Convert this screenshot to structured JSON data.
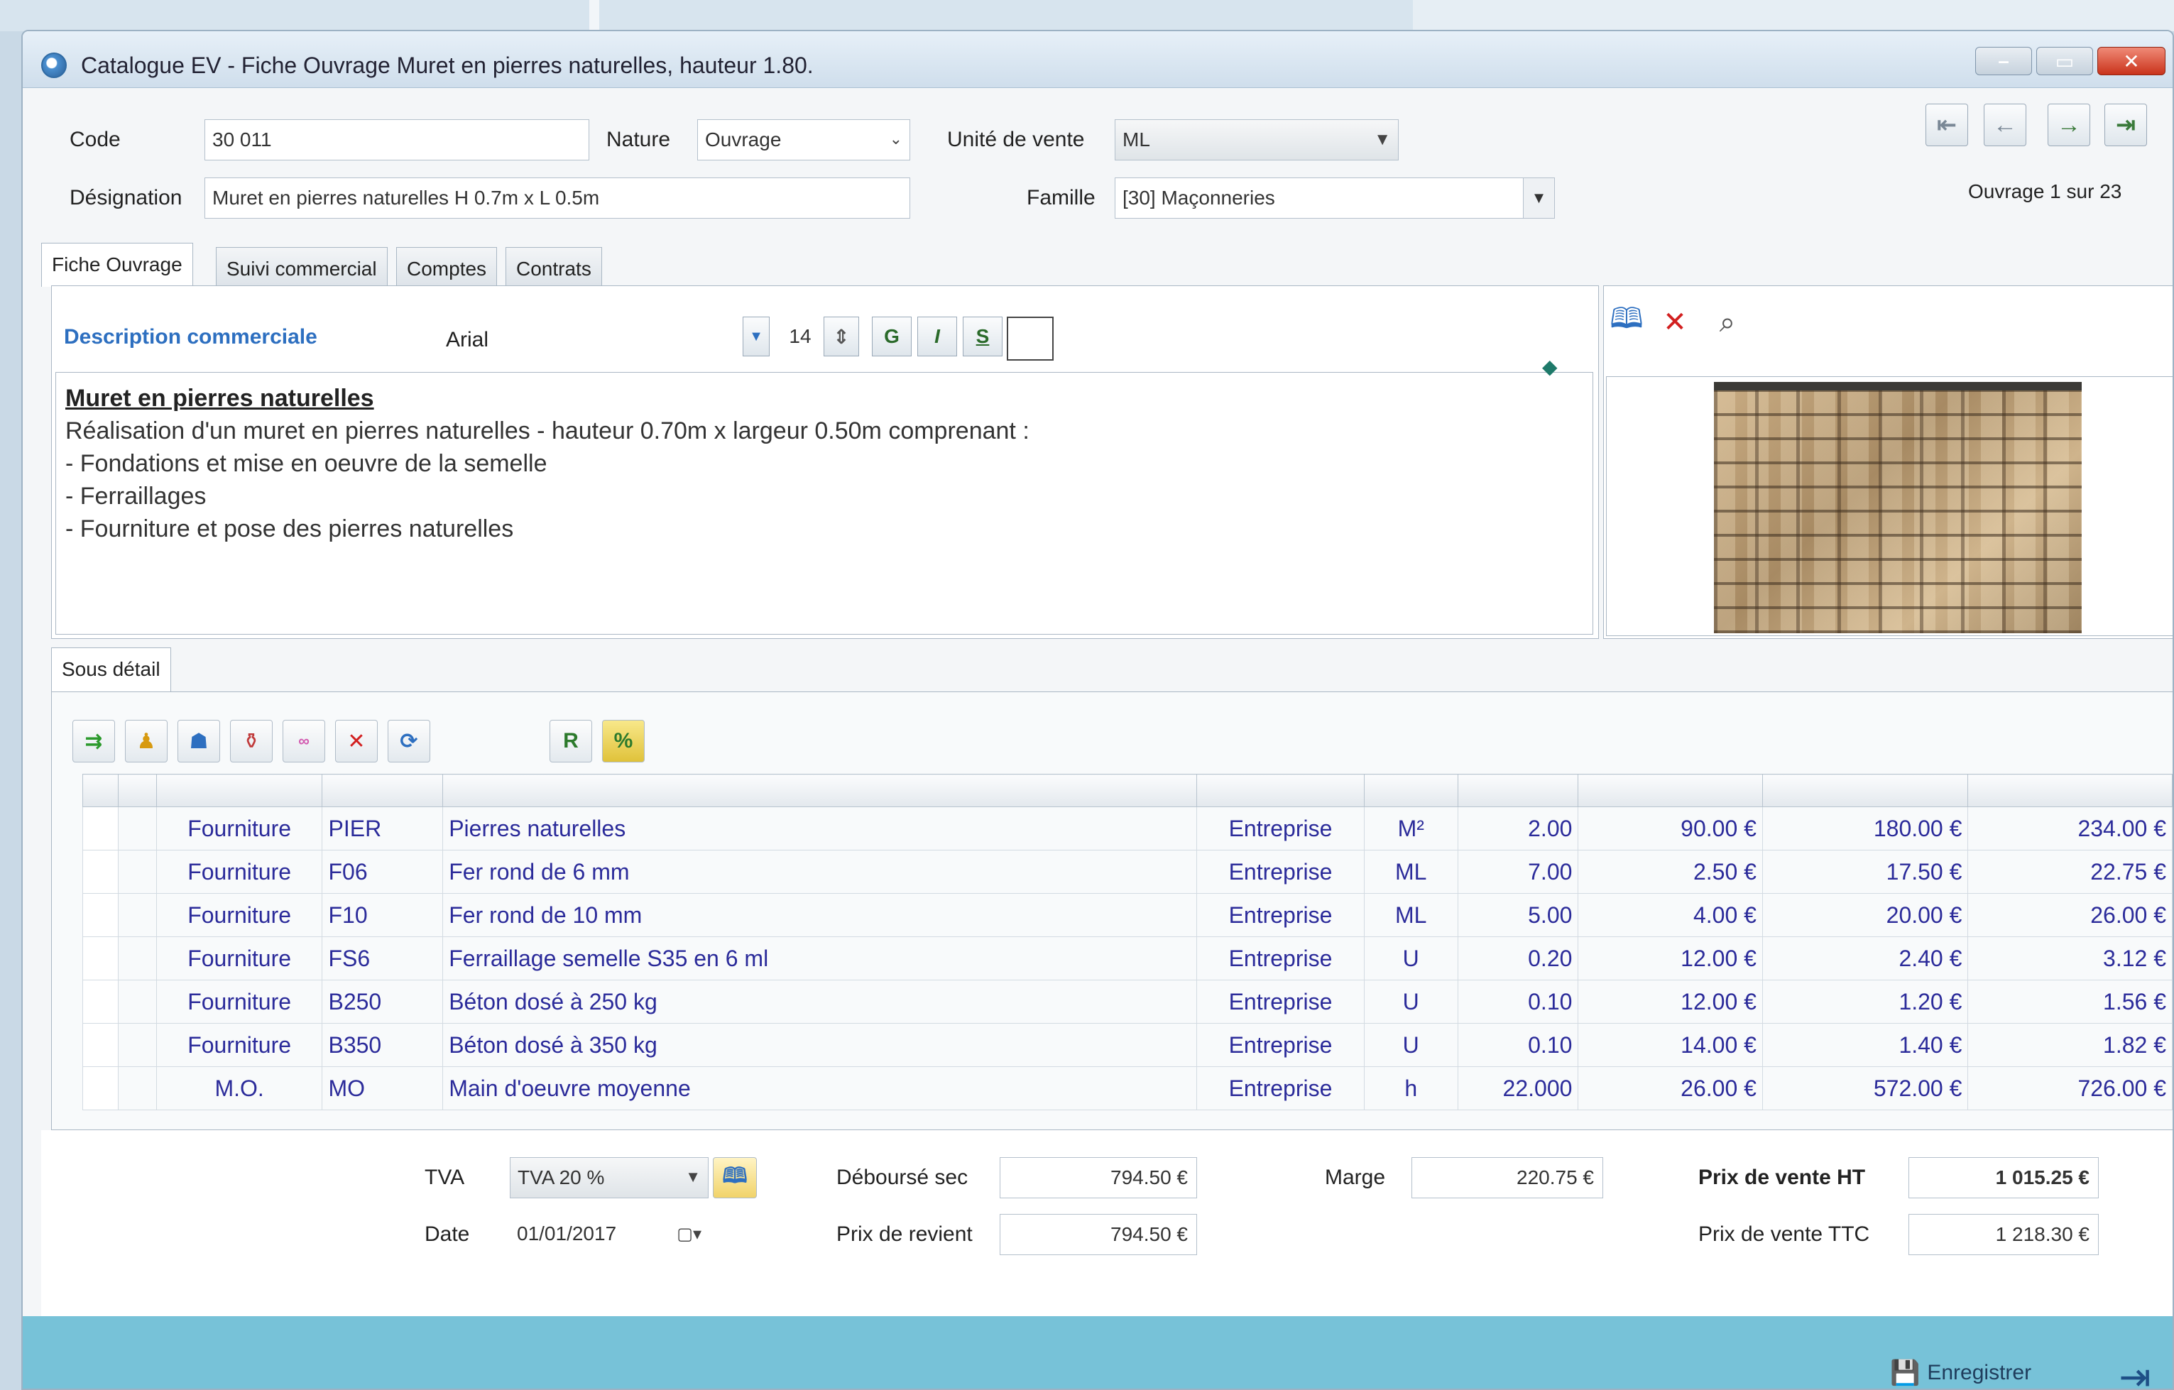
{
  "window": {
    "title": "Catalogue EV - Fiche Ouvrage Muret en pierres naturelles, hauteur 1.80."
  },
  "header": {
    "code_label": "Code",
    "code_value": "30 011",
    "nature_label": "Nature",
    "nature_value": "Ouvrage",
    "unite_label": "Unité de vente",
    "unite_value": "ML",
    "designation_label": "Désignation",
    "designation_value": "Muret en pierres naturelles H 0.7m x L 0.5m",
    "famille_label": "Famille",
    "famille_value": "[30] Maçonneries",
    "record_counter": "Ouvrage 1 sur 23"
  },
  "nav": {
    "first": "⇤",
    "prev": "←",
    "next": "→",
    "last": "⇥"
  },
  "tabs": [
    {
      "label": "Fiche Ouvrage"
    },
    {
      "label": "Suivi commercial"
    },
    {
      "label": "Comptes"
    },
    {
      "label": "Contrats"
    }
  ],
  "description": {
    "label": "Description commerciale",
    "font_name": "Arial",
    "font_size": "14",
    "bold_btn": "G",
    "italic_btn": "I",
    "underline_btn": "S",
    "title": "Muret en pierres naturelles",
    "lines": [
      "Réalisation d'un muret en pierres naturelles - hauteur 0.70m x largeur 0.50m comprenant :",
      "- Fondations et mise en oeuvre de la semelle",
      "- Ferraillages",
      "- Fourniture et pose des pierres naturelles"
    ]
  },
  "subdetail": {
    "tab_label": "Sous détail",
    "toolbar": {
      "r_btn": "R",
      "pct_btn": "%"
    },
    "rows": [
      {
        "nature": "Fourniture",
        "code": "PIER",
        "designation": "Pierres naturelles",
        "fournisseur": "Entreprise",
        "unite": "M²",
        "quantite": "2.00",
        "prix_achat": "90.00 €",
        "total_achat": "180.00 €",
        "total_ht": "234.00 €"
      },
      {
        "nature": "Fourniture",
        "code": "F06",
        "designation": "Fer rond de 6 mm",
        "fournisseur": "Entreprise",
        "unite": "ML",
        "quantite": "7.00",
        "prix_achat": "2.50 €",
        "total_achat": "17.50 €",
        "total_ht": "22.75 €"
      },
      {
        "nature": "Fourniture",
        "code": "F10",
        "designation": "Fer rond de 10 mm",
        "fournisseur": "Entreprise",
        "unite": "ML",
        "quantite": "5.00",
        "prix_achat": "4.00 €",
        "total_achat": "20.00 €",
        "total_ht": "26.00 €"
      },
      {
        "nature": "Fourniture",
        "code": "FS6",
        "designation": "Ferraillage semelle S35 en 6 ml",
        "fournisseur": "Entreprise",
        "unite": "U",
        "quantite": "0.20",
        "prix_achat": "12.00 €",
        "total_achat": "2.40 €",
        "total_ht": "3.12 €"
      },
      {
        "nature": "Fourniture",
        "code": "B250",
        "designation": "Béton dosé à 250 kg",
        "fournisseur": "Entreprise",
        "unite": "U",
        "quantite": "0.10",
        "prix_achat": "12.00 €",
        "total_achat": "1.20 €",
        "total_ht": "1.56 €"
      },
      {
        "nature": "Fourniture",
        "code": "B350",
        "designation": "Béton dosé à 350 kg",
        "fournisseur": "Entreprise",
        "unite": "U",
        "quantite": "0.10",
        "prix_achat": "14.00 €",
        "total_achat": "1.40 €",
        "total_ht": "1.82 €"
      },
      {
        "nature": "M.O.",
        "code": "MO",
        "designation": "Main d'oeuvre moyenne",
        "fournisseur": "Entreprise",
        "unite": "h",
        "quantite": "22.000",
        "prix_achat": "26.00 €",
        "total_achat": "572.00 €",
        "total_ht": "726.00 €"
      }
    ]
  },
  "footer": {
    "tva_label": "TVA",
    "tva_value": "TVA 20 %",
    "date_label": "Date",
    "date_value": "01/01/2017",
    "debourse_label": "Déboursé sec",
    "debourse_value": "794.50 €",
    "revient_label": "Prix de revient",
    "revient_value": "794.50 €",
    "marge_label": "Marge",
    "marge_value": "220.75 €",
    "pvht_label": "Prix de vente HT",
    "pvht_value": "1 015.25 €",
    "pvttc_label": "Prix de vente TTC",
    "pvttc_value": "1 218.30 €"
  },
  "actions": {
    "save_label": "Enregistrer"
  },
  "colors": {
    "accent": "#2d6fc0",
    "grid_text": "#2b2b9a",
    "bottom_bar": "#77c2d8",
    "close_button": "#c9331b"
  }
}
